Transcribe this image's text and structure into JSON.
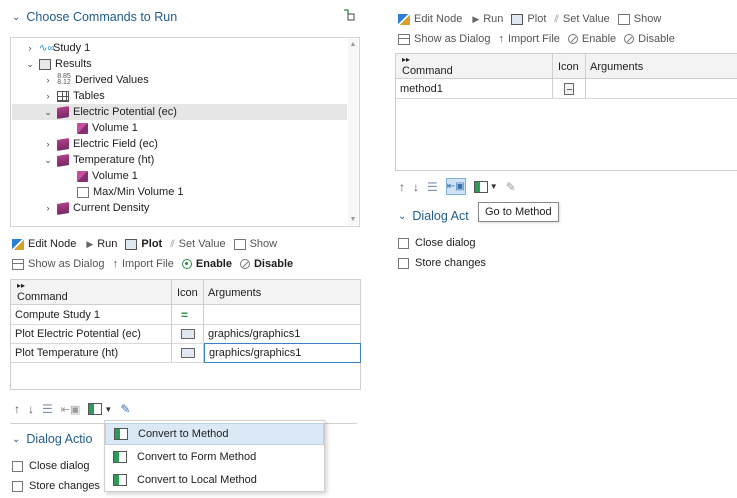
{
  "left": {
    "section_title": "Choose Commands to Run",
    "tree": [
      {
        "label": "Study 1",
        "twisty": "›",
        "icon": "study-icon"
      },
      {
        "label": "Results",
        "twisty": "⌄",
        "icon": "results-icon"
      },
      {
        "label": "Derived Values",
        "twisty": "›",
        "icon": "derived-values-icon",
        "icon_text": "8.85\n8.12"
      },
      {
        "label": "Tables",
        "twisty": "›",
        "icon": "table-icon"
      },
      {
        "label": "Electric Potential (ec)",
        "twisty": "⌄",
        "icon": "plot-group-icon"
      },
      {
        "label": "Volume 1",
        "twisty": "",
        "icon": "volume-icon"
      },
      {
        "label": "Electric Field (ec)",
        "twisty": "›",
        "icon": "plot-group-icon"
      },
      {
        "label": "Temperature (ht)",
        "twisty": "⌄",
        "icon": "plot-group-icon"
      },
      {
        "label": "Volume 1",
        "twisty": "",
        "icon": "volume-icon"
      },
      {
        "label": "Max/Min Volume 1",
        "twisty": "",
        "icon": "minmax-icon"
      },
      {
        "label": "Current Density",
        "twisty": "›",
        "icon": "plot-group-icon"
      }
    ],
    "toolbar": {
      "edit_node": "Edit Node",
      "run": "Run",
      "plot": "Plot",
      "set_value": "Set Value",
      "show": "Show",
      "show_as_dialog": "Show as Dialog",
      "import_file": "Import File",
      "enable": "Enable",
      "disable": "Disable"
    },
    "table": {
      "columns": [
        "Command",
        "Icon",
        "Arguments"
      ],
      "rows": [
        {
          "command": "Compute Study 1",
          "icon": "equals-icon",
          "arguments": ""
        },
        {
          "command": "Plot Electric Potential (ec)",
          "icon": "plot-icon",
          "arguments": "graphics/graphics1"
        },
        {
          "command": "Plot Temperature (ht)",
          "icon": "plot-icon",
          "arguments": "graphics/graphics1"
        }
      ]
    },
    "dialog_actions_title": "Dialog Actio",
    "checkboxes": [
      "Close dialog",
      "Store changes"
    ],
    "menu": [
      "Convert to Method",
      "Convert to Form Method",
      "Convert to Local Method"
    ]
  },
  "right": {
    "toolbar": {
      "edit_node": "Edit Node",
      "run": "Run",
      "plot": "Plot",
      "set_value": "Set Value",
      "show": "Show",
      "show_as_dialog": "Show as Dialog",
      "import_file": "Import File",
      "enable": "Enable",
      "disable": "Disable"
    },
    "table": {
      "columns": [
        "Command",
        "Icon",
        "Arguments"
      ],
      "rows": [
        {
          "command": "method1",
          "icon": "method-icon",
          "arguments": ""
        }
      ]
    },
    "dialog_actions_title": "Dialog Act",
    "tooltip": "Go to Method",
    "checkboxes": [
      "Close dialog",
      "Store changes"
    ]
  },
  "colors": {
    "section_title": "#1f5c8c",
    "enable_green": "#2b8a3e",
    "menu_highlight": "#dbe9f6",
    "selected_row": "#e6e6e6"
  }
}
